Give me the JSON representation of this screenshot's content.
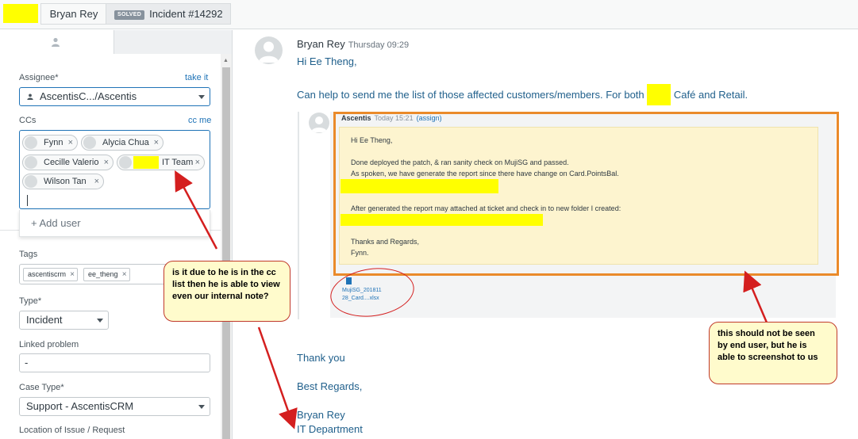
{
  "top_tabs": {
    "requester": "Bryan Rey",
    "status_badge": "SOLVED",
    "ticket": "Incident #14292"
  },
  "sidebar": {
    "tabs": [
      {
        "icon": "person-icon"
      },
      {
        "icon": "card-icon"
      }
    ],
    "assignee": {
      "label": "Assignee*",
      "action": "take it",
      "value": "AscentisC.../Ascentis"
    },
    "ccs": {
      "label": "CCs",
      "action": "cc me",
      "people": [
        "Fynn",
        "Alycia Chua",
        "Cecille Valerio",
        "IT Team",
        "Wilson Tan"
      ],
      "add_user": "+ Add user"
    },
    "tags": {
      "label": "Tags",
      "items": [
        "ascentiscrm",
        "ee_theng"
      ]
    },
    "type": {
      "label": "Type*",
      "value": "Incident"
    },
    "linked_problem": {
      "label": "Linked problem",
      "value": "-"
    },
    "case_type": {
      "label": "Case Type*",
      "value": "Support - AscentisCRM"
    },
    "location": {
      "label": "Location of Issue / Request"
    }
  },
  "conversation": {
    "author": "Bryan Rey",
    "time": "Thursday 09:29",
    "greeting": "Hi Ee Theng,",
    "line_before": "Can help to send me the list of those affected customers/members. For both",
    "line_after": "Café and Retail.",
    "quoted": {
      "author": "Ascentis",
      "time": "Today 15:21",
      "action": "(assign)",
      "lines": [
        "Hi Ee Theng,",
        "Done deployed the patch, & ran sanity check on MujiSG and passed.",
        "As spoken, we have generate the report since there have change on Card.PointsBal.",
        "After generated the report may attached at ticket and check in to new folder I created:",
        "Thanks and Regards,",
        "Fynn."
      ],
      "attachment_line1": "MujiSG_201811",
      "attachment_line2": "28_Card....xlsx"
    },
    "thank_you": "Thank you",
    "regards": "Best Regards,",
    "sig_name": "Bryan Rey",
    "sig_dept": "IT Department"
  },
  "annotations": {
    "callout_left": "is it due to he is in the cc\nlist then he is able to view\neven our internal note?",
    "callout_right": "this should not be seen\nby end user, but he is\nable to screenshot to us",
    "highlight_color": "#ffff00",
    "frame_color": "#ea8a2a",
    "arrow_color": "#d41f1f"
  }
}
